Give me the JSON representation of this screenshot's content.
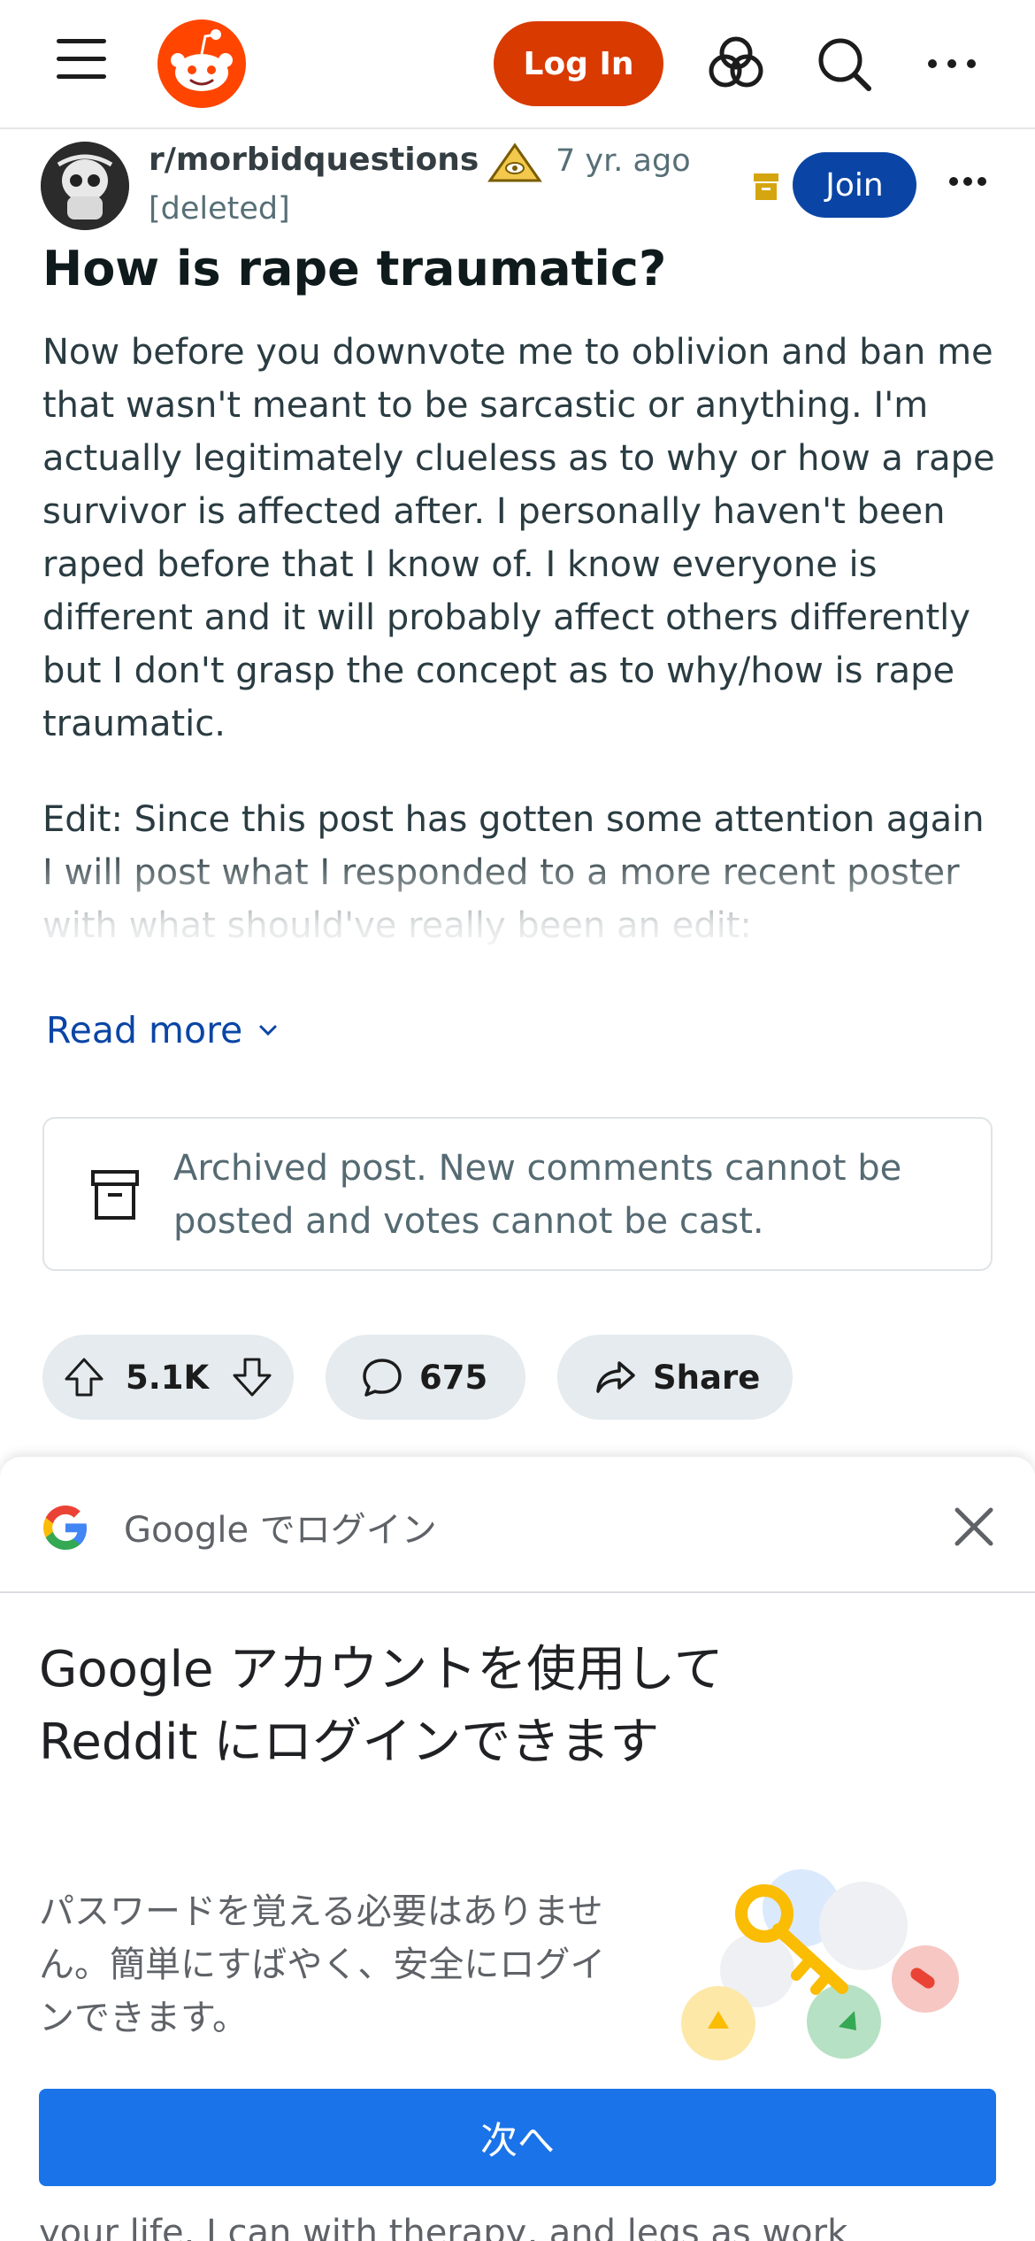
{
  "header": {
    "menu_icon": "hamburger-menu-icon",
    "logo_icon": "reddit-logo-icon",
    "login_label": "Log In",
    "icons": [
      "advertise-icon",
      "search-icon",
      "more-options-icon"
    ]
  },
  "post": {
    "subreddit": "r/morbidquestions",
    "age": "7 yr. ago",
    "author": "[deleted]",
    "join_label": "Join",
    "title": "How is rape traumatic?",
    "paragraphs": [
      "Now before you downvote me to oblivion and ban me that wasn't meant to be sarcastic or anything. I'm actually legitimately clueless as to why or how a rape survivor is affected after. I personally haven't been raped before that I know of. I know everyone is different and it will probably affect others differently but I don't grasp the concept as to why/how is rape traumatic.",
      "Edit: Since this post has gotten some attention again I will post what I responded to a more recent poster with what should've really been an edit:"
    ],
    "read_more": "Read more",
    "archived_notice": "Archived post. New comments cannot be posted and votes cannot be cast.",
    "votes": "5.1K",
    "comments": "675",
    "share_label": "Share"
  },
  "google_signin": {
    "header_title": "Google でログイン",
    "title": "Google アカウントを使用して Reddit にログインできます",
    "description": "パスワードを覚える必要はありません。簡単にすばやく、安全にログインできます。",
    "next_label": "次へ",
    "peek_text": "your life. I can with therapy, and legs as work"
  },
  "colors": {
    "login": "#d93a00",
    "join": "#0a45a5",
    "link": "#0a45a5",
    "google_blue": "#1a73e8"
  }
}
